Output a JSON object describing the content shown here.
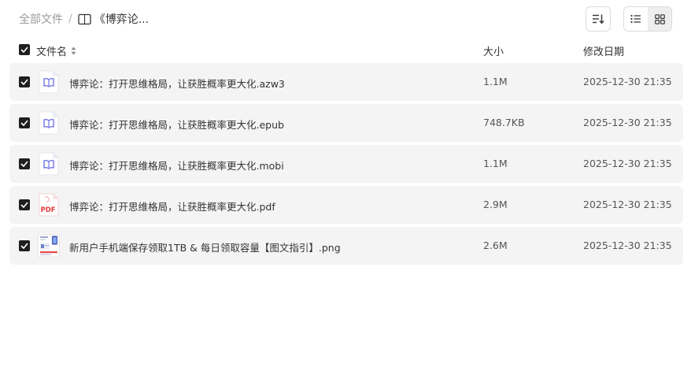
{
  "breadcrumb": {
    "root": "全部文件",
    "separator": "/",
    "current": "《博弈论..."
  },
  "header": {
    "name": "文件名",
    "size": "大小",
    "modified": "修改日期"
  },
  "files": [
    {
      "name": "博弈论：打开思维格局，让获胜概率更大化.azw3",
      "size": "1.1M",
      "date": "2025-12-30 21:35",
      "icon": "ebook-icon"
    },
    {
      "name": "博弈论：打开思维格局，让获胜概率更大化.epub",
      "size": "748.7KB",
      "date": "2025-12-30 21:35",
      "icon": "ebook-icon"
    },
    {
      "name": "博弈论：打开思维格局，让获胜概率更大化.mobi",
      "size": "1.1M",
      "date": "2025-12-30 21:35",
      "icon": "ebook-icon"
    },
    {
      "name": "博弈论：打开思维格局，让获胜概率更大化.pdf",
      "size": "2.9M",
      "date": "2025-12-30 21:35",
      "icon": "pdf-icon",
      "icon_label": "PDF"
    },
    {
      "name": "新用户手机端保存领取1TB & 每日领取容量【图文指引】.png",
      "size": "2.6M",
      "date": "2025-12-30 21:35",
      "icon": "image-thumbnail"
    }
  ],
  "colors": {
    "row_bg": "#f4f4f5",
    "checkbox": "#1f1f1f",
    "ebook_accent": "#7b7fe8",
    "pdf_red": "#e03c3c"
  }
}
